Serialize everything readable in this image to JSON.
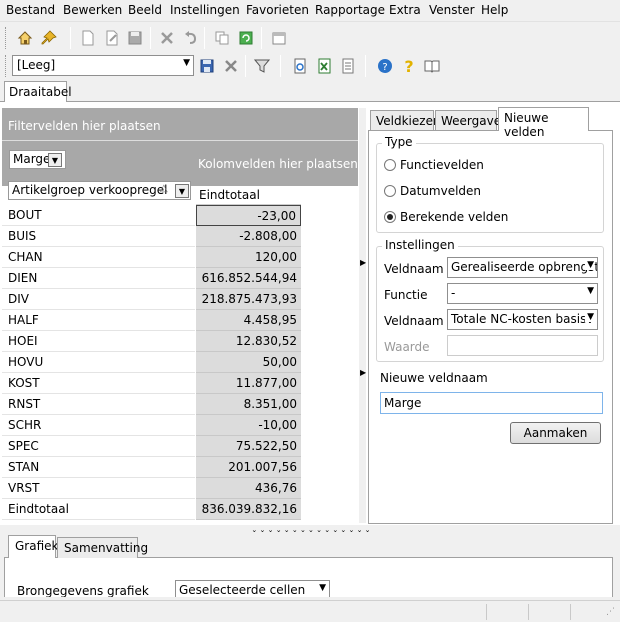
{
  "menu": [
    "Bestand",
    "Bewerken",
    "Beeld",
    "Instellingen",
    "Favorieten",
    "Rapportage",
    "Extra",
    "Venster",
    "Help"
  ],
  "toolbar": {
    "icons": [
      "home-icon",
      "pin-icon",
      "new-document-icon",
      "edit-icon",
      "save-icon",
      "delete-icon",
      "undo-icon",
      "copy-icon",
      "refresh-icon",
      "window-icon"
    ],
    "layout_select_value": "[Leeg]",
    "icons2": [
      "save-layout-icon",
      "delete-layout-icon",
      "filter-icon",
      "print-preview-icon",
      "excel-export-icon",
      "settings-icon",
      "help-icon",
      "question-icon",
      "book-icon"
    ]
  },
  "main_tab": "Draaitabel",
  "pivot": {
    "filter_zone": "Filtervelden hier plaatsen",
    "data_field": "Marge",
    "row_field": "Artikelgroep verkoopregel",
    "column_zone": "Kolomvelden hier plaatsen",
    "column_header": "Eindtotaal",
    "rows": [
      {
        "label": "BOUT",
        "value": "-23,00"
      },
      {
        "label": "BUIS",
        "value": "-2.808,00"
      },
      {
        "label": "CHAN",
        "value": "120,00"
      },
      {
        "label": "DIEN",
        "value": "616.852.544,94"
      },
      {
        "label": "DIV",
        "value": "218.875.473,93"
      },
      {
        "label": "HALF",
        "value": "4.458,95"
      },
      {
        "label": "HOEI",
        "value": "12.830,52"
      },
      {
        "label": "HOVU",
        "value": "50,00"
      },
      {
        "label": "KOST",
        "value": "11.877,00"
      },
      {
        "label": "RNST",
        "value": "8.351,00"
      },
      {
        "label": "SCHR",
        "value": "-10,00"
      },
      {
        "label": "SPEC",
        "value": "75.522,50"
      },
      {
        "label": "STAN",
        "value": "201.007,56"
      },
      {
        "label": "VRST",
        "value": "436,76"
      },
      {
        "label": "Eindtotaal",
        "value": "836.039.832,16"
      }
    ]
  },
  "right_tabs": [
    "Veldkiezer",
    "Weergave",
    "Nieuwe velden"
  ],
  "type_group": {
    "title": "Type",
    "options": [
      "Functievelden",
      "Datumvelden",
      "Berekende velden"
    ],
    "selected_index": 2
  },
  "settings_group": {
    "title": "Instellingen",
    "veldnaam1_label": "Veldnaam",
    "veldnaam1_value": "Gerealiseerde opbrengst",
    "functie_label": "Functie",
    "functie_value": "-",
    "veldnaam2_label": "Veldnaam",
    "veldnaam2_value": "Totale NC-kosten basisv",
    "waarde_label": "Waarde",
    "waarde_value": ""
  },
  "new_field": {
    "label": "Nieuwe veldnaam",
    "value": "Marge",
    "create_button": "Aanmaken"
  },
  "bottom_tabs": [
    "Grafiek",
    "Samenvatting"
  ],
  "bottom_panel": {
    "source_label": "Brongegevens grafiek",
    "source_value": "Geselecteerde cellen"
  }
}
